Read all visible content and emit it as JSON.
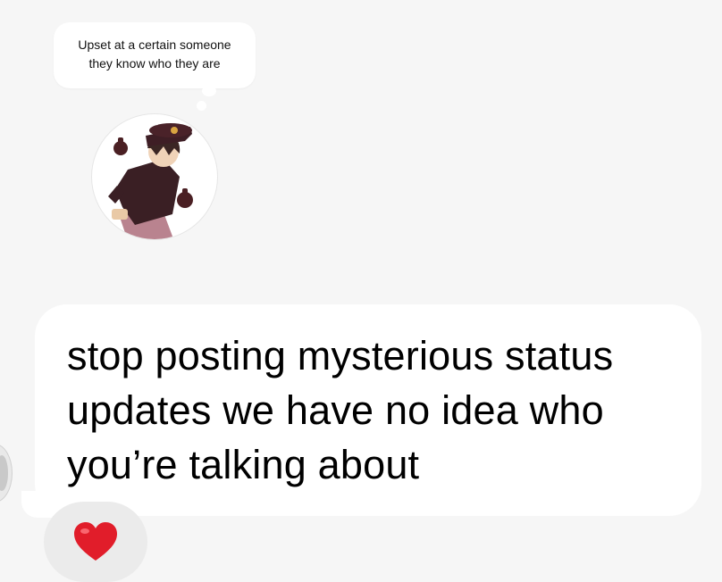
{
  "status": {
    "lines": [
      "Upset at a certain someone",
      "they know who they are"
    ]
  },
  "profile": {
    "avatar_icon": "anime-character-avatar"
  },
  "message": {
    "text": "stop posting mysterious status updates we have no idea who you’re talking about"
  },
  "reaction": {
    "icon": "red-heart-icon",
    "color": "#e11d2a"
  },
  "colors": {
    "background": "#f6f6f6",
    "bubble": "#ffffff",
    "reaction_pill": "#ebebeb"
  }
}
